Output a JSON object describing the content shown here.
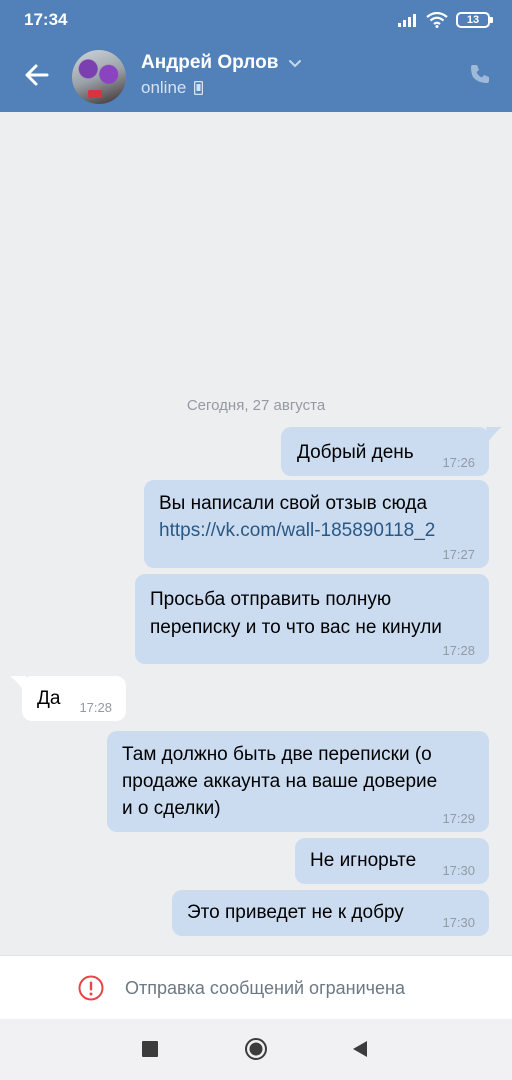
{
  "status_bar": {
    "time": "17:34",
    "battery": "13"
  },
  "header": {
    "contact_name": "Андрей Орлов",
    "presence": "online",
    "accent_color": "#5181b8"
  },
  "chat": {
    "date_separator": "Сегодня, 27 августа",
    "messages": [
      {
        "direction": "out",
        "lines": [
          "Добрый день"
        ],
        "time": "17:26"
      },
      {
        "direction": "out",
        "lines": [
          "Вы написали свой отзыв сюда"
        ],
        "link": "https://vk.com/wall-185890118_2",
        "time": "17:27"
      },
      {
        "direction": "out",
        "lines": [
          "Просьба отправить полную",
          "переписку и то что вас не кинули"
        ],
        "time": "17:28"
      },
      {
        "direction": "in",
        "lines": [
          "Да"
        ],
        "time": "17:28"
      },
      {
        "direction": "out",
        "lines": [
          "Там должно быть две переписки (о",
          "продаже аккаунта на ваше доверие",
          "и о сделки)"
        ],
        "time": "17:29"
      },
      {
        "direction": "out",
        "lines": [
          "Не игнорьте"
        ],
        "time": "17:30"
      },
      {
        "direction": "out",
        "lines": [
          "Это приведет не к добру"
        ],
        "time": "17:30"
      }
    ]
  },
  "composer": {
    "restricted_text": "Отправка сообщений ограничена"
  },
  "icons": {
    "back": "arrow-left-icon",
    "chevron": "chevron-down-icon",
    "device": "mobile-device-icon",
    "phone": "phone-icon",
    "warning": "exclamation-circle-icon",
    "nav": [
      "square-recents-icon",
      "circle-home-icon",
      "triangle-back-icon"
    ]
  }
}
